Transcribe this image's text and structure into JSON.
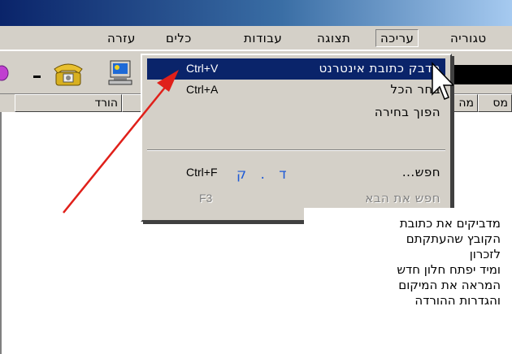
{
  "menubar": {
    "items": [
      "טגוריה",
      "עריכה",
      "תצוגה",
      "עבודות",
      "כלים",
      "עזרה"
    ],
    "active": "עריכה"
  },
  "toolbar": {
    "icons": [
      "purple-circle-icon",
      "dropdown-arrow-icon",
      "telephone-icon",
      "computer-icon"
    ]
  },
  "columns": {
    "headers": [
      "הורד",
      "",
      "מה",
      "מס"
    ]
  },
  "edit_menu": {
    "items": [
      {
        "label": "הדבק כתובת אינטרנט",
        "shortcut": "Ctrl+V",
        "highlighted": true
      },
      {
        "label": "בחר הכל",
        "shortcut": "Ctrl+A"
      },
      {
        "label": "הפוך בחירה",
        "shortcut": ""
      },
      {
        "label": "חפש...",
        "shortcut": "Ctrl+F",
        "note": "ד . ק"
      },
      {
        "label": "חפש את הבא",
        "shortcut": "F3",
        "disabled": true
      }
    ]
  },
  "callout": {
    "lines": [
      "מדביקים את כתובת",
      "הקובץ שהעתקתם",
      "לזכרון",
      "ומיד יפתח חלון חדש",
      "המראה את המיקום",
      "והגדרות ההורדה"
    ]
  },
  "colors": {
    "menu_bg": "#d4d0c8",
    "highlight": "#0a246a",
    "arrow": "#e0201a",
    "note": "#1e5ad6"
  }
}
